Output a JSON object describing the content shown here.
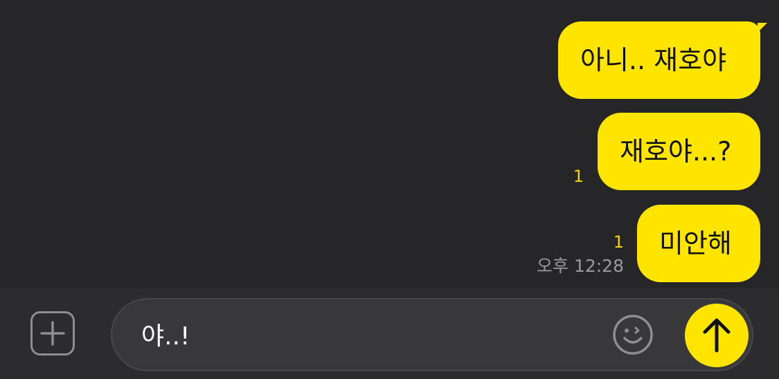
{
  "messages": [
    {
      "text": "아니.. 재호야",
      "unread": ""
    },
    {
      "text": "재호야...?",
      "unread": "1"
    },
    {
      "text": "미안해",
      "unread": "1",
      "time": "오후 12:28"
    }
  ],
  "composer": {
    "value": "야..!",
    "plus_icon": "plus-icon",
    "emoji_icon": "smiley-icon",
    "send_icon": "arrow-up-icon"
  },
  "colors": {
    "bubble": "#FEE500",
    "background": "#262628",
    "unread": "#F4D400"
  }
}
